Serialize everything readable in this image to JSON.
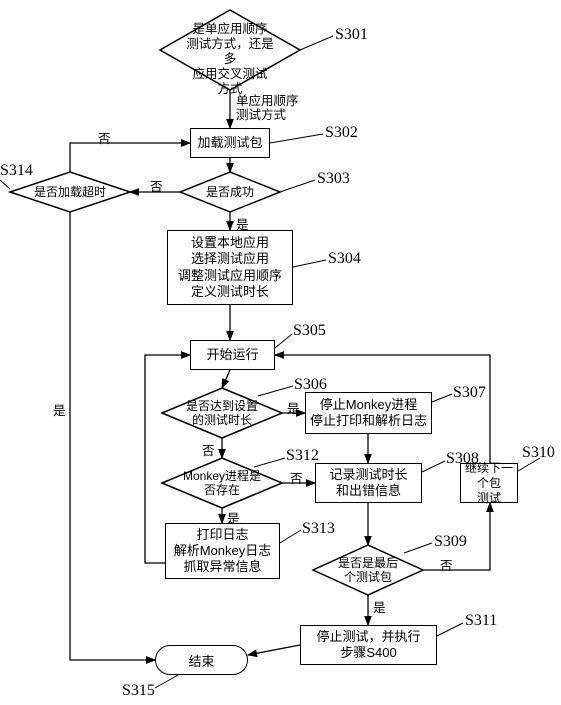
{
  "chart_data": {
    "type": "flowchart",
    "nodes": [
      {
        "id": "S301",
        "shape": "decision",
        "text": "是单应用顺序测试方式，还是多应用交叉测试方式"
      },
      {
        "id": "S302",
        "shape": "process",
        "text": "加载测试包"
      },
      {
        "id": "S303",
        "shape": "decision",
        "text": "是否成功"
      },
      {
        "id": "S304",
        "shape": "process",
        "text": "设置本地应用\n选择测试应用\n调整测试应用顺序\n定义测试时长"
      },
      {
        "id": "S305",
        "shape": "process",
        "text": "开始运行"
      },
      {
        "id": "S306",
        "shape": "decision",
        "text": "是否达到设置的测试时长"
      },
      {
        "id": "S307",
        "shape": "process",
        "text": "停止Monkey进程\n停止打印和解析日志"
      },
      {
        "id": "S308",
        "shape": "process",
        "text": "记录测试时长和出错信息"
      },
      {
        "id": "S309",
        "shape": "decision",
        "text": "是否是最后个测试包"
      },
      {
        "id": "S310",
        "shape": "process",
        "text": "继续下一个包测试"
      },
      {
        "id": "S311",
        "shape": "process",
        "text": "停止测试，并执行步骤S400"
      },
      {
        "id": "S312",
        "shape": "decision",
        "text": "Monkey进程是否存在"
      },
      {
        "id": "S313",
        "shape": "process",
        "text": "打印日志\n解析Monkey日志\n抓取异常信息"
      },
      {
        "id": "S314",
        "shape": "decision",
        "text": "是否加载超时"
      },
      {
        "id": "S315",
        "shape": "terminator",
        "text": "结束"
      }
    ],
    "edges": [
      {
        "from": "S301",
        "to": "S302",
        "label": "单应用顺序测试方式"
      },
      {
        "from": "S302",
        "to": "S303"
      },
      {
        "from": "S303",
        "to": "S304",
        "label": "是"
      },
      {
        "from": "S303",
        "to": "S314",
        "label": "否"
      },
      {
        "from": "S314",
        "to": "S302",
        "label": "否"
      },
      {
        "from": "S314",
        "to": "S315",
        "label": "是"
      },
      {
        "from": "S304",
        "to": "S305"
      },
      {
        "from": "S305",
        "to": "S306"
      },
      {
        "from": "S306",
        "to": "S307",
        "label": "是"
      },
      {
        "from": "S306",
        "to": "S312",
        "label": "否"
      },
      {
        "from": "S307",
        "to": "S308"
      },
      {
        "from": "S312",
        "to": "S308",
        "label": "否"
      },
      {
        "from": "S312",
        "to": "S313",
        "label": "是"
      },
      {
        "from": "S313",
        "to": "S305"
      },
      {
        "from": "S308",
        "to": "S309"
      },
      {
        "from": "S309",
        "to": "S310",
        "label": "否"
      },
      {
        "from": "S309",
        "to": "S311",
        "label": "是"
      },
      {
        "from": "S310",
        "to": "S305"
      },
      {
        "from": "S311",
        "to": "S315"
      }
    ]
  },
  "labels": {
    "s301": "S301",
    "s302": "S302",
    "s303": "S303",
    "s304": "S304",
    "s305": "S305",
    "s306": "S306",
    "s307": "S307",
    "s308": "S308",
    "s309": "S309",
    "s310": "S310",
    "s311": "S311",
    "s312": "S312",
    "s313": "S313",
    "s314": "S314",
    "s315": "S315"
  },
  "node_text": {
    "s301": "是单应用顺序\n测试方式，还是多\n应用交叉测试\n方式",
    "s302": "加载测试包",
    "s303": "是否成功",
    "s304_l1": "设置本地应用",
    "s304_l2": "选择测试应用",
    "s304_l3": "调整测试应用顺序",
    "s304_l4": "定义测试时长",
    "s305": "开始运行",
    "s306": "是否达到设置\n的测试时长",
    "s307_l1": "停止Monkey进程",
    "s307_l2": "停止打印和解析日志",
    "s308_l1": "记录测试时长",
    "s308_l2": "和出错信息",
    "s309": "是否是最后\n个测试包",
    "s310_l1": "继续下一个包",
    "s310_l2": "测试",
    "s311_l1": "停止测试，并执行",
    "s311_l2": "步骤S400",
    "s312": "Monkey进程是\n否存在",
    "s313_l1": "打印日志",
    "s313_l2": "解析Monkey日志",
    "s313_l3": "抓取异常信息",
    "s314": "是否加载超时",
    "s315": "结束"
  },
  "edge_labels": {
    "single_mode": "单应用顺序\n测试方式",
    "yes": "是",
    "no": "否"
  }
}
